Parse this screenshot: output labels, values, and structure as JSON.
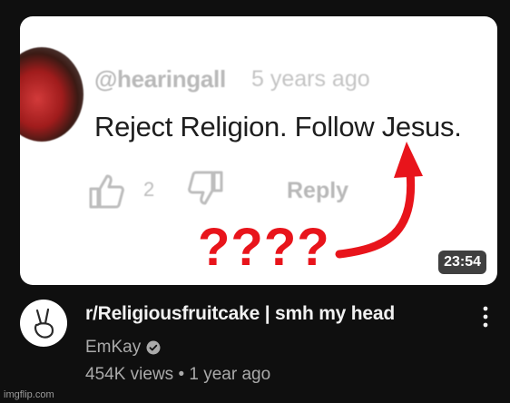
{
  "thumbnail": {
    "comment": {
      "handle": "@hearingall",
      "time_ago": "5 years ago",
      "text": "Reject Religion. Follow Jesus.",
      "like_count": "2",
      "reply_label": "Reply"
    },
    "annotation_text": "????",
    "duration": "23:54"
  },
  "video": {
    "title": "r/Religiousfruitcake | smh my head",
    "channel": "EmKay",
    "meta": "454K views • 1 year ago"
  },
  "watermark": "imgflip.com",
  "colors": {
    "annotation_red": "#e8141b",
    "background": "#0f0f0f",
    "secondary_text": "#aaaaaa"
  },
  "icons": [
    "like-icon",
    "dislike-icon",
    "verified-icon",
    "more-vert-icon",
    "peace-hand-icon"
  ]
}
